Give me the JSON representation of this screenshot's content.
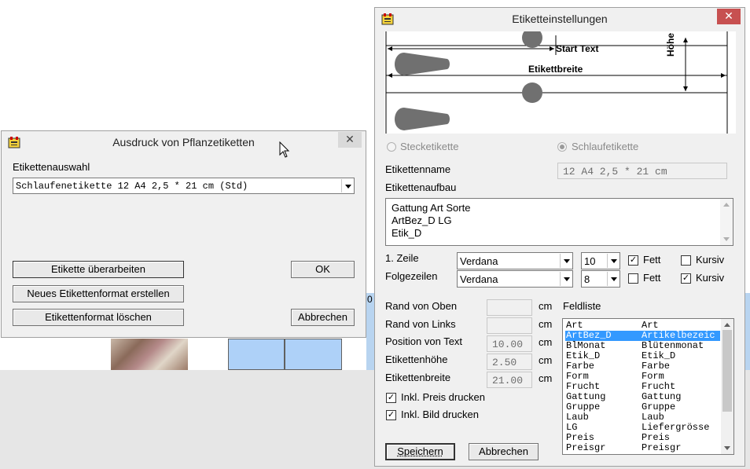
{
  "dialog1": {
    "title": "Ausdruck von Pflanzetiketten",
    "etikettenauswahl_label": "Etikettenauswahl",
    "etikettenauswahl_value": "Schlaufenetikette 12 A4 2,5 * 21 cm (Std)",
    "btn_ueberarbeiten": "Etikette überarbeiten",
    "btn_ok": "OK",
    "btn_neues_format": "Neues Etikettenformat erstellen",
    "btn_format_loeschen": "Etikettenformat löschen",
    "btn_abbrechen": "Abbrechen"
  },
  "bg_partial_text": "0",
  "dialog2": {
    "title": "Etiketteinstellungen",
    "preview": {
      "start_text": "Start Text",
      "etikettbreite": "Etikettbreite",
      "hoehe": "Höhe"
    },
    "radio_stecketikette": "Stecketikette",
    "radio_schlaufetikette": "Schlaufetikette",
    "etikettenname_label": "Etikettenname",
    "etikettenname_value": "12 A4 2,5 * 21 cm",
    "etikettenaufbau_label": "Etikettenaufbau",
    "aufbau_lines": [
      "Gattung Art Sorte",
      "ArtBez_D LG",
      "Etik_D"
    ],
    "zeile1_label": "1. Zeile",
    "zeile1_font": "Verdana",
    "zeile1_size": "10",
    "zeile1_fett": "Fett",
    "zeile1_kursiv": "Kursiv",
    "folgezeilen_label": "Folgezeilen",
    "folge_font": "Verdana",
    "folge_size": "8",
    "folge_fett": "Fett",
    "folge_kursiv": "Kursiv",
    "rand_oben_label": "Rand von Oben",
    "rand_links_label": "Rand von Links",
    "position_text_label": "Position von Text",
    "position_text_value": "10.00",
    "etikettenhoehe_label": "Etikettenhöhe",
    "etikettenhoehe_value": "2.50",
    "etikettenbreite_label": "Etikettenbreite",
    "etikettenbreite_value": "21.00",
    "unit_cm": "cm",
    "feldliste_label": "Feldliste",
    "feldliste": [
      {
        "code": "Art",
        "name": "Art"
      },
      {
        "code": "ArtBez_D",
        "name": "Artikelbezeic"
      },
      {
        "code": "BlMonat",
        "name": "Blütenmonat"
      },
      {
        "code": "Etik_D",
        "name": "Etik_D"
      },
      {
        "code": "Farbe",
        "name": "Farbe"
      },
      {
        "code": "Form",
        "name": "Form"
      },
      {
        "code": "Frucht",
        "name": "Frucht"
      },
      {
        "code": "Gattung",
        "name": "Gattung"
      },
      {
        "code": "Gruppe",
        "name": "Gruppe"
      },
      {
        "code": "Laub",
        "name": "Laub"
      },
      {
        "code": "LG",
        "name": "Liefergrösse"
      },
      {
        "code": "Preis",
        "name": "Preis"
      },
      {
        "code": "Preisgr",
        "name": "Preisgr"
      }
    ],
    "feldliste_selected_index": 1,
    "inkl_preis": "Inkl. Preis drucken",
    "inkl_bild": "Inkl. Bild drucken",
    "btn_speichern": "Speichern",
    "btn_abbrechen": "Abbrechen"
  },
  "close_glyph": "✕"
}
